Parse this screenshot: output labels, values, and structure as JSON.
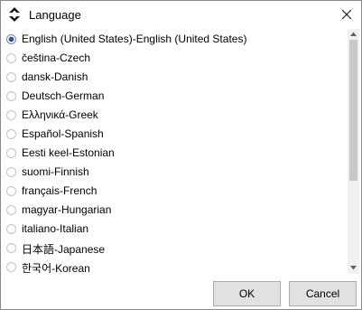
{
  "window": {
    "title": "Language",
    "close_icon": "close-icon",
    "app_icon": "diamond-arrows-icon"
  },
  "languages": {
    "selected": "English (United States)-English (United States)",
    "items": [
      {
        "label": "English (United States)-English (United States)"
      },
      {
        "label": "čeština-Czech"
      },
      {
        "label": "dansk-Danish"
      },
      {
        "label": "Deutsch-German"
      },
      {
        "label": "Ελληνικά-Greek"
      },
      {
        "label": "Español-Spanish"
      },
      {
        "label": "Eesti keel-Estonian"
      },
      {
        "label": "suomi-Finnish"
      },
      {
        "label": "français-French"
      },
      {
        "label": "magyar-Hungarian"
      },
      {
        "label": "italiano-Italian"
      },
      {
        "label": "日本語-Japanese"
      },
      {
        "label": "한국어-Korean"
      }
    ]
  },
  "scrollbar": {
    "thumb_fraction": 0.63,
    "scroll_position": 0
  },
  "buttons": {
    "ok_label": "OK",
    "cancel_label": "Cancel"
  },
  "colors": {
    "radio_selected": "#2f52a5",
    "button_face": "#e1e1e1",
    "scrollbar_thumb": "#c8c8c8"
  }
}
